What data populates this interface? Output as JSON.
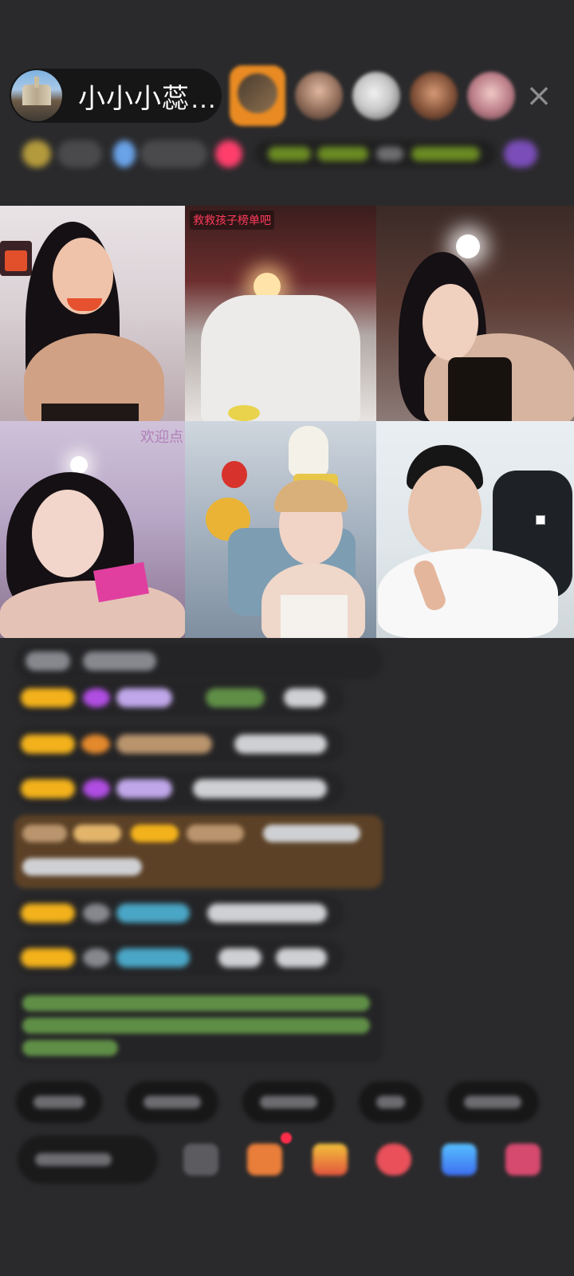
{
  "header": {
    "host_name": "小小小蕊…",
    "close_icon": "×"
  },
  "video_grid": {
    "cell2_banner": "救救孩子榜单吧",
    "cell4_overlay": "欢迎点"
  },
  "colors": {
    "background": "#2a2a2c",
    "badge": "#f3b21b",
    "notification": "#ff2d4a"
  }
}
